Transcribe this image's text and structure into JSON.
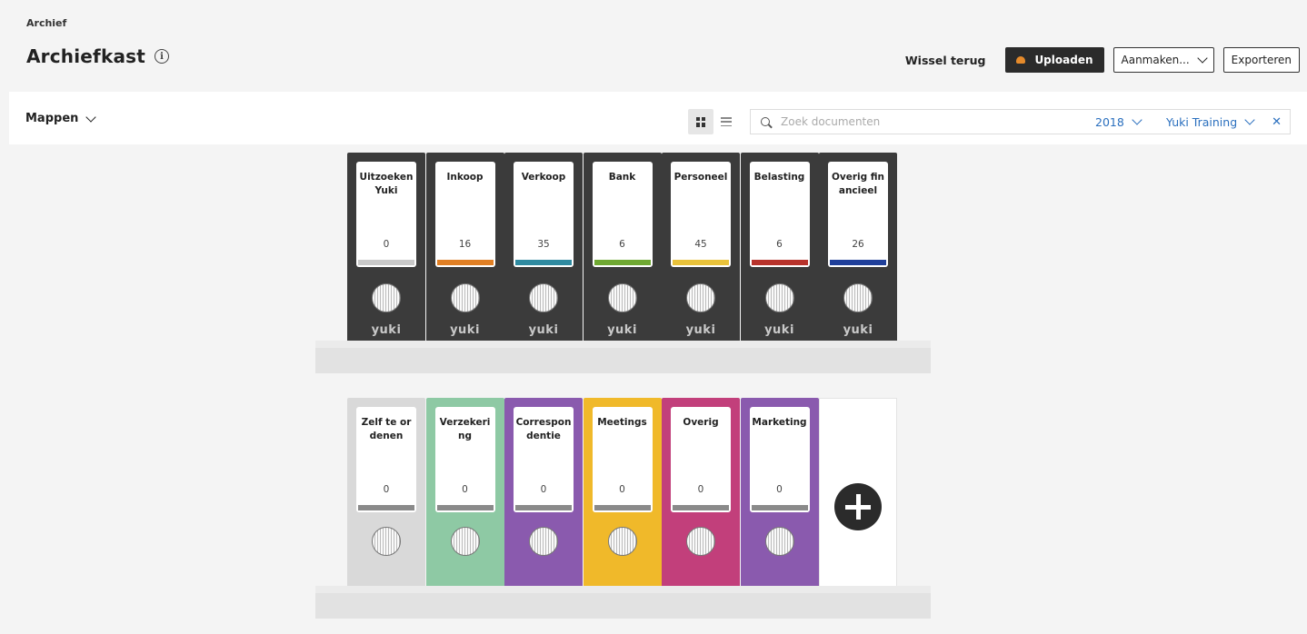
{
  "breadcrumb": "Archief",
  "page_title": "Archiefkast",
  "info_glyph": "i",
  "actions": {
    "switch_back": "Wissel terug",
    "upload": "Uploaden",
    "create": "Aanmaken...",
    "export": "Exporteren"
  },
  "toolbar": {
    "folders_label": "Mappen",
    "search_placeholder": "Zoek documenten",
    "year": "2018",
    "administration": "Yuki Training",
    "clear": "✕"
  },
  "brand_text": "yuki",
  "row1": [
    {
      "name": "Uitzoeken Yuki",
      "count": "0",
      "stripe": "#c8c8c8"
    },
    {
      "name": "Inkoop",
      "count": "16",
      "stripe": "#e07f24"
    },
    {
      "name": "Verkoop",
      "count": "35",
      "stripe": "#2f8aa0"
    },
    {
      "name": "Bank",
      "count": "6",
      "stripe": "#6fa832"
    },
    {
      "name": "Personeel",
      "count": "45",
      "stripe": "#e9c23a"
    },
    {
      "name": "Belasting",
      "count": "6",
      "stripe": "#b8332c"
    },
    {
      "name": "Overig financieel",
      "count": "26",
      "stripe": "#1f3f9a"
    }
  ],
  "row2": [
    {
      "name": "Zelf te ordenen",
      "count": "0",
      "color": "#d9d9d9"
    },
    {
      "name": "Verzekering",
      "count": "0",
      "color": "#8ec9a4"
    },
    {
      "name": "Correspondentie",
      "count": "0",
      "color": "#8a5aae"
    },
    {
      "name": "Meetings",
      "count": "0",
      "color": "#f0b92a"
    },
    {
      "name": "Overig",
      "count": "0",
      "color": "#c23f7b"
    },
    {
      "name": "Marketing",
      "count": "0",
      "color": "#8a5aae"
    }
  ]
}
